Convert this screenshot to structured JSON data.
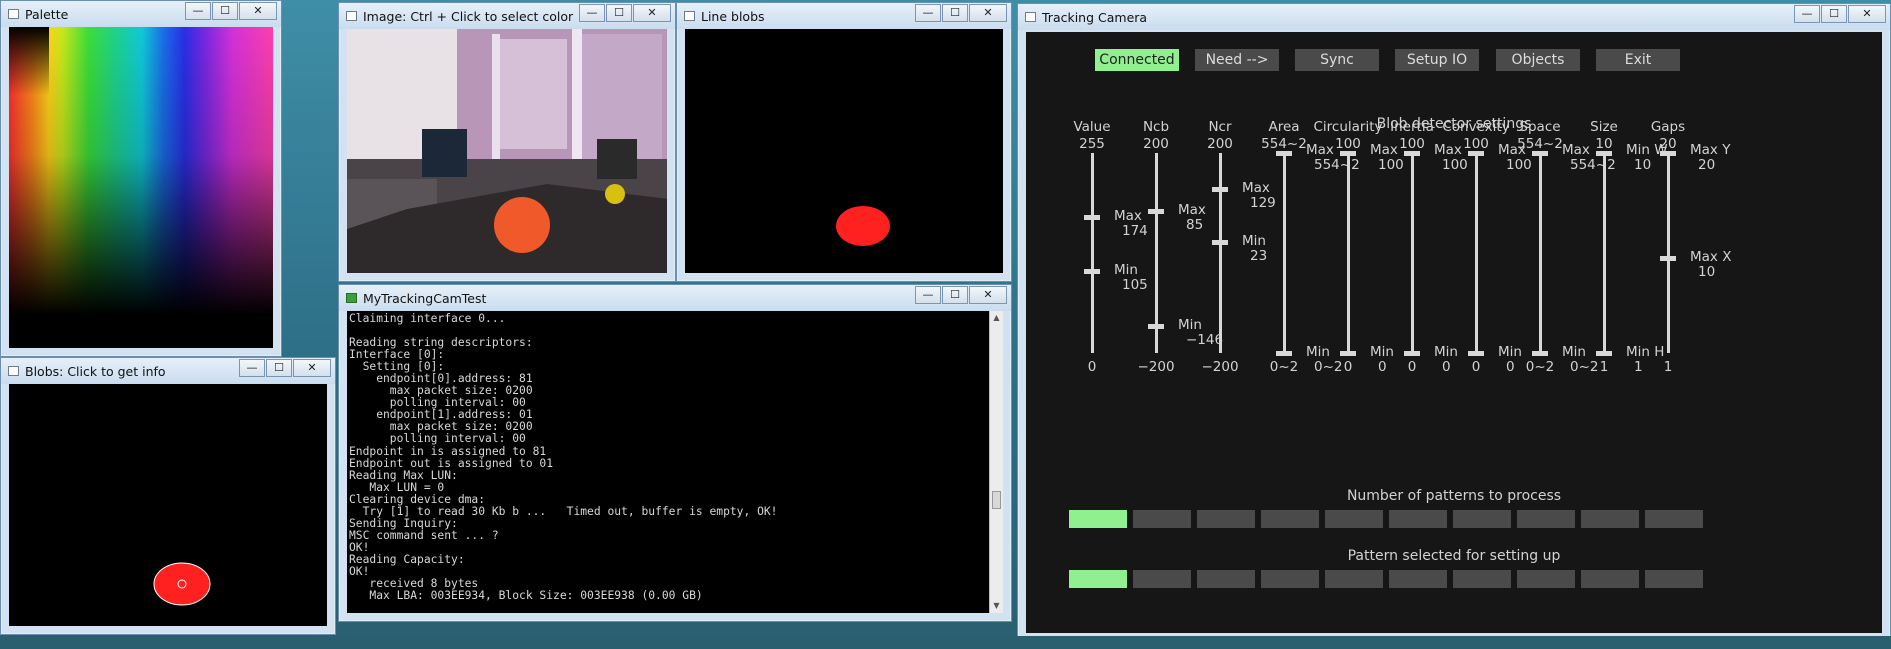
{
  "colors": {
    "accent_on": "#90f090",
    "button_off": "#4a4a4a",
    "blob": "#ff2020"
  },
  "windows": {
    "palette": {
      "title": "Palette",
      "min": "—",
      "max": "☐",
      "close": "✕"
    },
    "blobs": {
      "title": "Blobs: Click to get info",
      "min": "—",
      "max": "☐",
      "close": "✕"
    },
    "image": {
      "title": "Image: Ctrl + Click to select color",
      "min": "—",
      "max": "☐",
      "close": "✕"
    },
    "line_blobs": {
      "title": "Line blobs",
      "min": "—",
      "max": "☐",
      "close": "✕"
    },
    "console": {
      "title": "MyTrackingCamTest",
      "min": "—",
      "max": "☐",
      "close": "✕",
      "lines": [
        "Claiming interface 0...",
        "",
        "Reading string descriptors:",
        "Interface [0]:",
        "  Setting [0]:",
        "    endpoint[0].address: 81",
        "      max packet size: 0200",
        "      polling interval: 00",
        "    endpoint[1].address: 01",
        "      max packet size: 0200",
        "      polling interval: 00",
        "Endpoint in is assigned to 81",
        "Endpoint out is assigned to 01",
        "Reading Max LUN:",
        "   Max LUN = 0",
        "Clearing device dma:",
        "  Try [1] to read 30 Kb b ...   Timed out, buffer is empty, OK!",
        "Sending Inquiry:",
        "MSC command sent ... ?",
        "OK!",
        "Reading Capacity:",
        "OK!",
        "   received 8 bytes",
        "   Max LBA: 003EE934, Block Size: 003EE938 (0.00 GB)"
      ]
    },
    "tracking": {
      "title": "Tracking Camera",
      "min": "—",
      "max": "☐",
      "close": "✕"
    }
  },
  "tracking": {
    "buttons": [
      {
        "label": "Connected",
        "active": true
      },
      {
        "label": "Need -->",
        "active": false
      },
      {
        "label": "Sync",
        "active": false
      },
      {
        "label": "Setup IO",
        "active": false
      },
      {
        "label": "Objects",
        "active": false
      },
      {
        "label": "Exit",
        "active": false
      }
    ],
    "section_title": "Blob detector settings",
    "sliders": [
      {
        "name": "Value",
        "top": "255",
        "bottom": "0",
        "range": [
          0,
          255
        ],
        "handles": [
          {
            "label": "Max",
            "value": "174",
            "v": 174
          },
          {
            "label": "Min",
            "value": "105",
            "v": 105
          }
        ]
      },
      {
        "name": "Ncb",
        "top": "200",
        "bottom": "−200",
        "range": [
          -200,
          200
        ],
        "handles": [
          {
            "label": "Max",
            "value": "85",
            "v": 85
          },
          {
            "label": "Min",
            "value": "−146",
            "v": -146
          }
        ]
      },
      {
        "name": "Ncr",
        "top": "200",
        "bottom": "−200",
        "range": [
          -200,
          200
        ],
        "handles": [
          {
            "label": "Max",
            "value": "129",
            "v": 129
          },
          {
            "label": "Min",
            "value": "23",
            "v": 23
          }
        ]
      },
      {
        "name": "Area",
        "top": "554~2",
        "bottom": "0~2",
        "range": [
          0,
          1
        ],
        "handles": [
          {
            "label": "Max",
            "value": "554~2",
            "v": 1
          },
          {
            "label": "Min",
            "value": "0~2",
            "v": 0
          }
        ]
      },
      {
        "name": "Circularity",
        "top": "100",
        "bottom": "0",
        "range": [
          0,
          100
        ],
        "handles": [
          {
            "label": "Max",
            "value": "100",
            "v": 100
          },
          {
            "label": "Min",
            "value": "0",
            "v": 0
          }
        ]
      },
      {
        "name": "Inertia",
        "top": "100",
        "bottom": "0",
        "range": [
          0,
          100
        ],
        "handles": [
          {
            "label": "Max",
            "value": "100",
            "v": 100
          },
          {
            "label": "Min",
            "value": "0",
            "v": 0
          }
        ]
      },
      {
        "name": "Convexity",
        "top": "100",
        "bottom": "0",
        "range": [
          0,
          100
        ],
        "handles": [
          {
            "label": "Max",
            "value": "100",
            "v": 100
          },
          {
            "label": "Min",
            "value": "0",
            "v": 0
          }
        ]
      },
      {
        "name": "Space",
        "top": "554~2",
        "bottom": "0~2",
        "range": [
          0,
          1
        ],
        "handles": [
          {
            "label": "Max",
            "value": "554~2",
            "v": 1
          },
          {
            "label": "Min",
            "value": "0~2",
            "v": 0
          }
        ]
      },
      {
        "name": "Size",
        "top": "10",
        "bottom": "1",
        "range": [
          1,
          10
        ],
        "handles": [
          {
            "label": "Min  W",
            "value": "10",
            "v": 10
          },
          {
            "label": "Min  H",
            "value": "1",
            "v": 1
          }
        ]
      },
      {
        "name": "Gaps",
        "top": "20",
        "bottom": "1",
        "range": [
          1,
          20
        ],
        "handles": [
          {
            "label": "Max  Y",
            "value": "20",
            "v": 20
          },
          {
            "label": "Max  X",
            "value": "10",
            "v": 10
          }
        ]
      }
    ],
    "patterns_title": "Number of patterns to process",
    "patterns_count": 10,
    "patterns_active": 1,
    "selected_title": "Pattern selected for setting up",
    "selected_active": 1
  }
}
